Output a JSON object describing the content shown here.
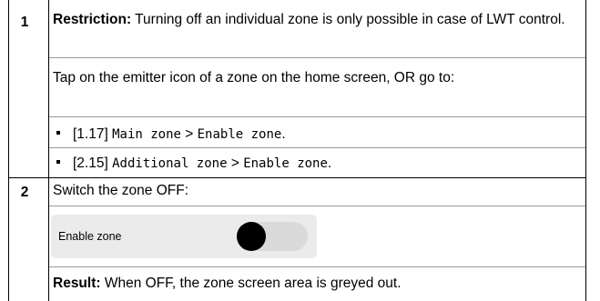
{
  "step1": {
    "number": "1",
    "restriction_label": "Restriction:",
    "restriction_text": " Turning off an individual zone is only possible in case of LWT control.",
    "instruction": "Tap on the emitter icon of a zone on the home screen, OR go to:",
    "bullets": [
      {
        "ref": "[1.17]",
        "zone": "Main zone",
        "sep": " > ",
        "setting": "Enable zone",
        "end": "."
      },
      {
        "ref": "[2.15]",
        "zone": "Additional zone",
        "sep": " > ",
        "setting": "Enable zone",
        "end": "."
      }
    ]
  },
  "step2": {
    "number": "2",
    "instruction": "Switch the zone OFF:",
    "widget": {
      "label": "Enable zone",
      "toggle_state": "off"
    },
    "result_label": "Result:",
    "result_text": " When OFF, the zone screen area is greyed out."
  }
}
